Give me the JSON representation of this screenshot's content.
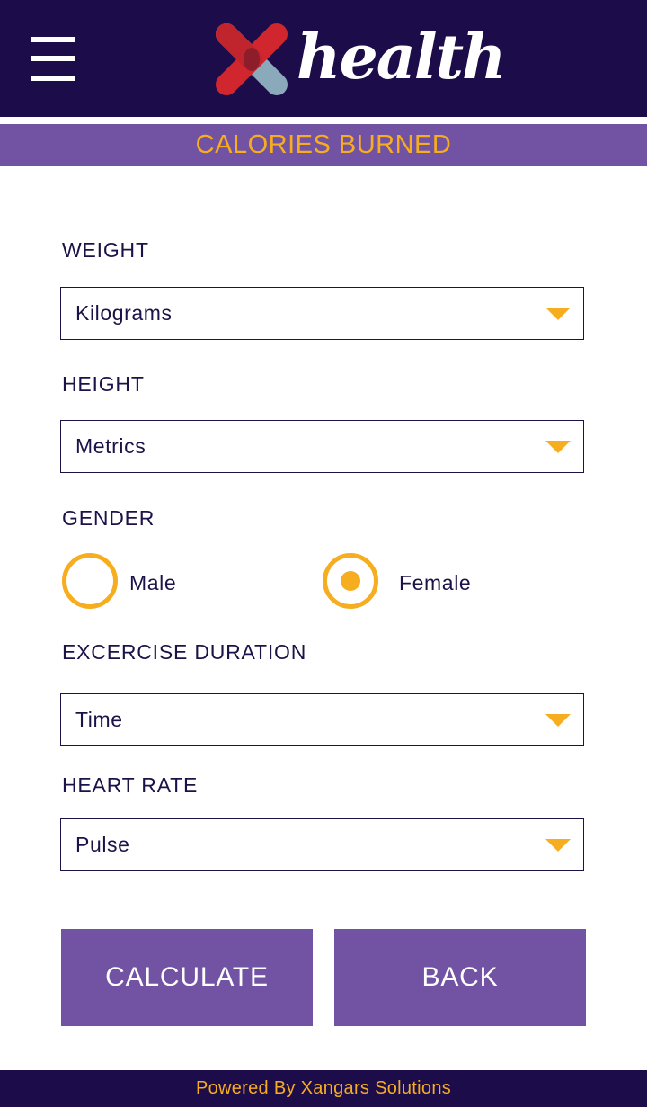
{
  "header": {
    "brand_text": "health",
    "menu_icon": "hamburger-menu-icon",
    "logo_colors": {
      "red": "#d1262e",
      "blue": "#8aa9bb"
    }
  },
  "page": {
    "title": "CALORIES BURNED"
  },
  "form": {
    "weight": {
      "label": "WEIGHT",
      "value": "Kilograms"
    },
    "height": {
      "label": "HEIGHT",
      "value": "Metrics"
    },
    "gender": {
      "label": "GENDER",
      "options": [
        {
          "label": "Male",
          "selected": false
        },
        {
          "label": "Female",
          "selected": true
        }
      ]
    },
    "duration": {
      "label": "EXCERCISE DURATION",
      "value": "Time"
    },
    "heart_rate": {
      "label": "HEART RATE",
      "value": "Pulse"
    }
  },
  "buttons": {
    "calculate": "CALCULATE",
    "back": "BACK"
  },
  "footer": {
    "text": "Powered By Xangars Solutions"
  },
  "colors": {
    "navy": "#1c0c4a",
    "purple": "#7152a3",
    "accent": "#f6ad1f",
    "text": "#1c1248"
  }
}
